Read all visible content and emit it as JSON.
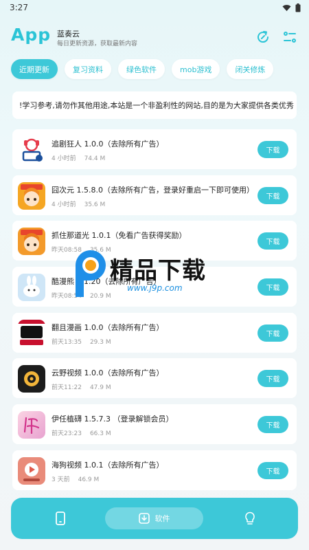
{
  "status": {
    "time": "3:27"
  },
  "header": {
    "app_title": "App",
    "site_name": "蓝奏云",
    "site_desc": "每日更新资源，获取最新内容"
  },
  "tabs": [
    {
      "label": "近期更新",
      "active": true
    },
    {
      "label": "复习资料",
      "active": false
    },
    {
      "label": "绿色软件",
      "active": false
    },
    {
      "label": "mob游戏",
      "active": false
    },
    {
      "label": "闭关修炼",
      "active": false
    }
  ],
  "notice": "!学习参考,请勿作其他用途,本站是一个非盈利性的网站,目的是为大家提供各类优秀",
  "download_label": "下载",
  "items": [
    {
      "name": "追剧狂人 1.0.0（去除所有广告）",
      "time": "4 小时前",
      "size": "74.4 M",
      "icon": "zhuiju-app-icon"
    },
    {
      "name": "囧次元 1.5.8.0（去除所有广告，登录好重启一下即可使用）",
      "time": "4 小时前",
      "size": "35.6 M",
      "icon": "jiongciyuan-app-icon"
    },
    {
      "name": "抓住那道光 1.0.1（免看广告获得奖励）",
      "time": "昨天08:58",
      "size": "35.6 M",
      "icon": "zhuazhu-app-icon"
    },
    {
      "name": "酷漫熊 2.1.20（去除所有广告）",
      "time": "昨天08:54",
      "size": "20.9 M",
      "icon": "kumanxiong-app-icon"
    },
    {
      "name": "翻且漫画 1.0.0（去除所有广告）",
      "time": "前天13:35",
      "size": "29.3 M",
      "icon": "manhua-app-icon"
    },
    {
      "name": "云野视频 1.0.0（去除所有广告）",
      "time": "前天11:22",
      "size": "47.9 M",
      "icon": "yunye-app-icon"
    },
    {
      "name": "伊任植礴 1.5.7.3 （登录解锁会员）",
      "time": "前天23:23",
      "size": "66.3 M",
      "icon": "yiren-app-icon"
    },
    {
      "name": "海狗视频 1.0.1（去除所有广告）",
      "time": "3 天前",
      "size": "46.9 M",
      "icon": "haigou-app-icon"
    }
  ],
  "watermark": {
    "text": "精品下载",
    "url": "www.j9p.com"
  },
  "bottom_nav": {
    "software_label": "软件"
  },
  "colors": {
    "accent": "#3dc8d8",
    "title": "#2bc4d6"
  }
}
